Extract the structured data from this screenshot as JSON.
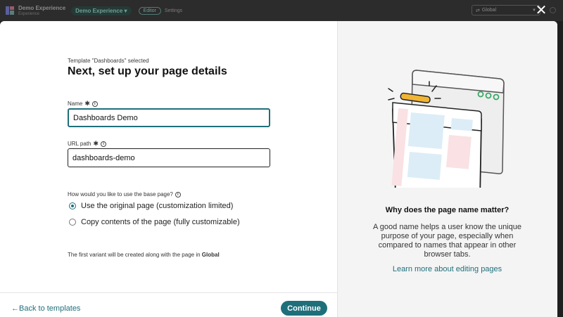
{
  "app": {
    "name": "Demo Experience",
    "subtitle": "Experience",
    "experience_select": "Demo Experience",
    "modes": [
      "Editor",
      "Settings"
    ],
    "locale_select": "Global"
  },
  "modal": {
    "eyebrow": "Template \"Dashboards\" selected",
    "title": "Next, set up your page details",
    "name_field": {
      "label": "Name",
      "value": "Dashboards Demo"
    },
    "url_field": {
      "label": "URL path",
      "value": "dashboards-demo"
    },
    "question": "How would you like to use the base page?",
    "options": [
      {
        "label": "Use the original page (customization limited)",
        "checked": true
      },
      {
        "label": "Copy contents of the page (fully customizable)",
        "checked": false
      }
    ],
    "footnote_prefix": "The first variant will be created along with the page in ",
    "footnote_bold": "Global",
    "back_label": "Back to templates",
    "continue_label": "Continue"
  },
  "help_panel": {
    "heading": "Why does the page name matter?",
    "body": "A good name helps a user know the unique purpose of your page, especially when compared to names that appear in other browser tabs.",
    "link": "Learn more about editing pages"
  },
  "colors": {
    "accent": "#1f6f7b",
    "highlight": "#f0b535",
    "panel_bg": "#f4f4f4",
    "illus_blue": "#dcedf7",
    "illus_pink": "#f9e1e4",
    "illus_green": "#3aa866"
  },
  "icons": {
    "close": "close-icon",
    "info": "info-icon",
    "back": "arrow-left-icon"
  }
}
